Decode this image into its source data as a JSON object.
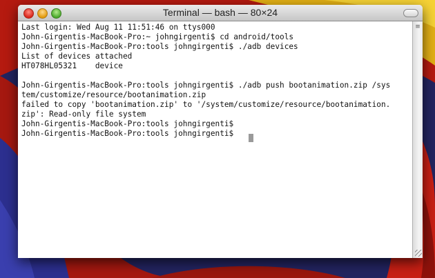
{
  "window": {
    "title": "Terminal — bash — 80×24"
  },
  "terminal": {
    "lines": [
      "Last login: Wed Aug 11 11:51:46 on ttys000",
      "John-Girgentis-MacBook-Pro:~ johngirgenti$ cd android/tools",
      "John-Girgentis-MacBook-Pro:tools johngirgenti$ ./adb devices",
      "List of devices attached",
      "HT078HL05321    device",
      "",
      "John-Girgentis-MacBook-Pro:tools johngirgenti$ ./adb push bootanimation.zip /sys",
      "tem/customize/resource/bootanimation.zip",
      "failed to copy 'bootanimation.zip' to '/system/customize/resource/bootanimation.",
      "zip': Read-only file system",
      "John-Girgentis-MacBook-Pro:tools johngirgenti$",
      "John-Girgentis-MacBook-Pro:tools johngirgenti$ "
    ]
  },
  "icons": {
    "scroll": "scroll-list-icon",
    "resize": "resize-grip-icon"
  },
  "colors": {
    "wallpaper_red": "#c21d12",
    "wallpaper_yellow": "#f3c21a",
    "wallpaper_blue": "#2a2f8c",
    "close": "#d8261b",
    "minimize": "#e29a0c",
    "zoom": "#4aa82b"
  }
}
